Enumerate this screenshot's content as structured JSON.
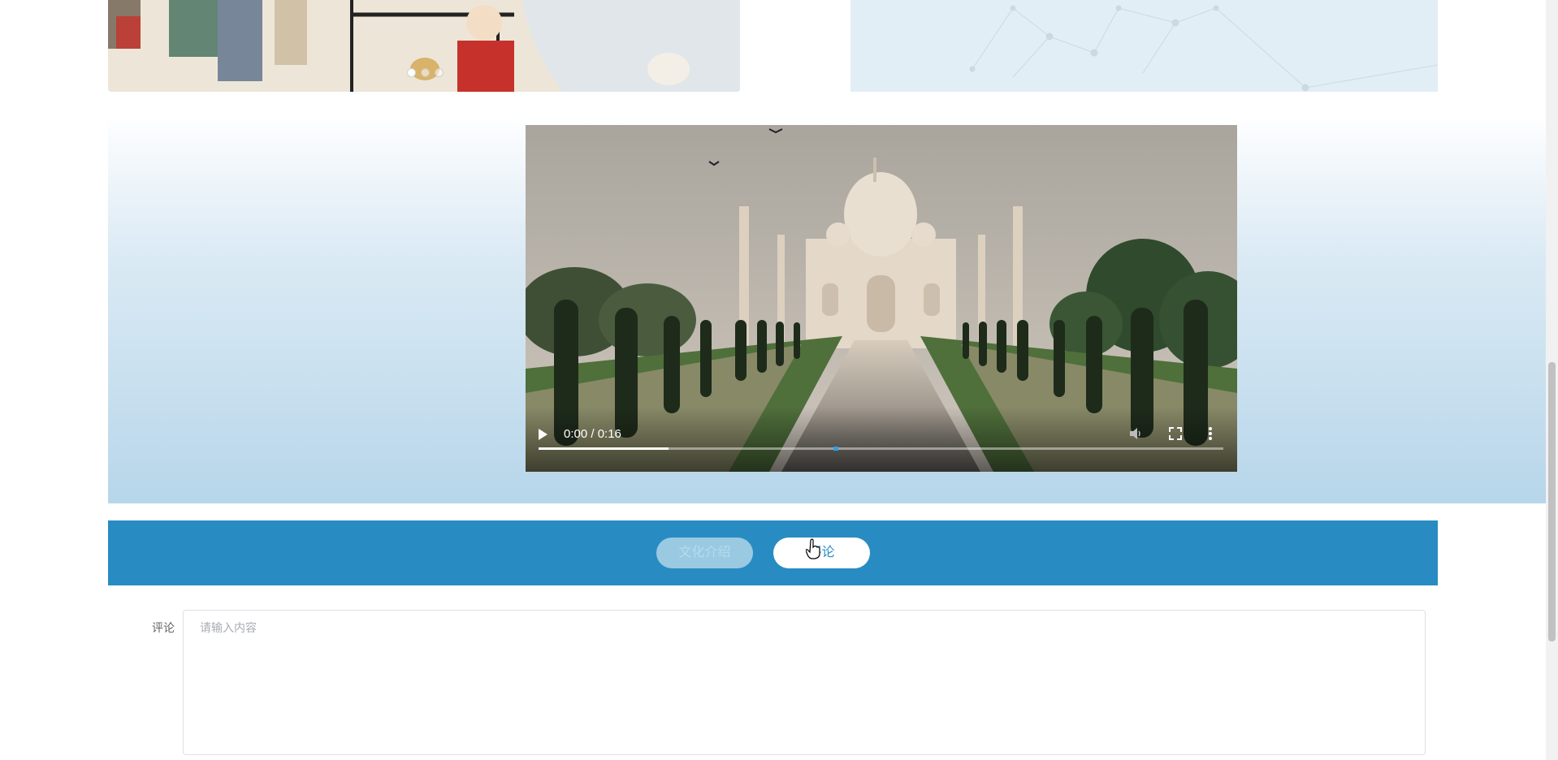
{
  "carousel": {
    "slide_count": 3,
    "active_index": 0
  },
  "video": {
    "time_display": "0:00 / 0:16",
    "current_time": "0:00",
    "duration": "0:16",
    "buffered_fraction": 0.19,
    "icons": [
      "play-icon",
      "volume-icon",
      "fullscreen-icon",
      "more-options-icon"
    ]
  },
  "tabs": [
    {
      "label": "文化介绍",
      "active": false
    },
    {
      "label": "评论",
      "active": true
    }
  ],
  "comment": {
    "label": "评论",
    "placeholder": "请输入内容"
  },
  "colors": {
    "tabbar": "#288cc2",
    "accent": "#2a8bc4",
    "progress_marker": "#2f9fe0"
  }
}
